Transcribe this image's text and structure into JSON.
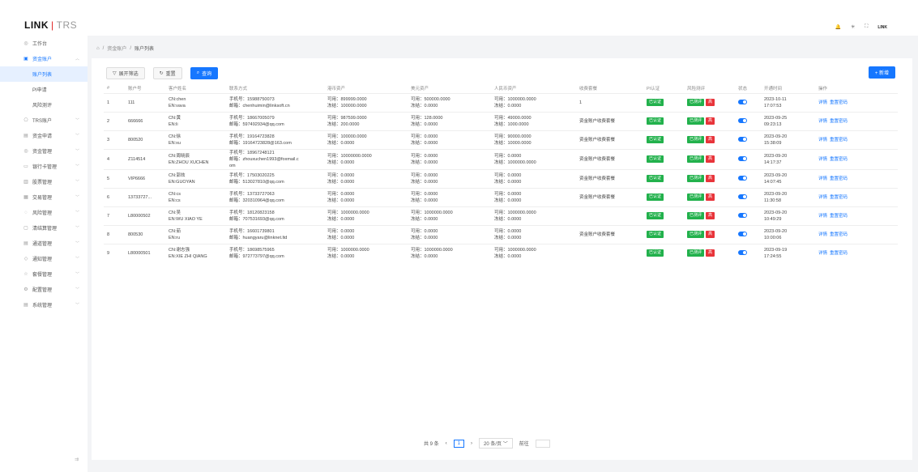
{
  "app": {
    "logo_bold": "LINK",
    "logo_sep": "|",
    "logo_rest": "TRS"
  },
  "topbar": {
    "bell": "🔔",
    "star": "✳",
    "expand": "⛶",
    "user": "LINK"
  },
  "sidebar": {
    "items": [
      {
        "label": "工作台",
        "icon": "◎",
        "chev": ""
      },
      {
        "label": "资金账户",
        "icon": "▣",
        "chev": "︿",
        "open": true
      },
      {
        "label": "TRS账户",
        "icon": "⎔",
        "chev": "﹀"
      },
      {
        "label": "资金申请",
        "icon": "▤",
        "chev": "﹀"
      },
      {
        "label": "资金管理",
        "icon": "◎",
        "chev": "﹀"
      },
      {
        "label": "银行卡管理",
        "icon": "▭",
        "chev": "﹀"
      },
      {
        "label": "股票管理",
        "icon": "▥",
        "chev": "﹀"
      },
      {
        "label": "交易管理",
        "icon": "▦",
        "chev": "﹀"
      },
      {
        "label": "风险管理",
        "icon": "◌",
        "chev": "﹀"
      },
      {
        "label": "清结算管理",
        "icon": "▢",
        "chev": "﹀"
      },
      {
        "label": "通道管理",
        "icon": "▤",
        "chev": "﹀"
      },
      {
        "label": "通知管理",
        "icon": "◇",
        "chev": "﹀"
      },
      {
        "label": "套餐管理",
        "icon": "☆",
        "chev": "﹀"
      },
      {
        "label": "配置管理",
        "icon": "⚙",
        "chev": "﹀"
      },
      {
        "label": "系统管理",
        "icon": "▤",
        "chev": "﹀"
      }
    ],
    "sub_items": [
      "账户列表",
      "PI申请",
      "风险测评"
    ],
    "collapse": "⇉"
  },
  "breadcrumb": {
    "home": "⌂",
    "sep": "/",
    "level1": "资金账户",
    "level2": "账户列表"
  },
  "toolbar": {
    "expand_filter": "展开筛选",
    "reset": "重置",
    "query": "查询",
    "add": "+ 新增"
  },
  "table": {
    "headers": [
      "#",
      "账户号",
      "客户姓名",
      "联系方式",
      "港币资产",
      "美元资产",
      "人民币资产",
      "收费套餐",
      "PI认证",
      "风险测评",
      "状态",
      "开通时间",
      "操作"
    ],
    "rows": [
      {
        "idx": "1",
        "acct": "111",
        "name1": "CN:chen",
        "name2": "EN:vava",
        "c1": "手机号：15988750073",
        "c2": "邮箱：chenhuimin@linksoft.cn",
        "hk1": "可用：899999.0000",
        "hk2": "冻结：100000.0000",
        "us1": "可用：500000.0000",
        "us2": "冻结：0.0000",
        "cn1": "可用：1000000.0000",
        "cn2": "冻结：0.0000",
        "fee": "1",
        "date": "2023-10-11",
        "time": "17:07:53"
      },
      {
        "idx": "2",
        "acct": "666666",
        "name1": "CN:黄",
        "name2": "EN:li",
        "c1": "手机号：18667005079",
        "c2": "邮箱：597492934@qq.com",
        "hk1": "可用：987599.0000",
        "hk2": "冻结：200.0000",
        "us1": "可用：128.0000",
        "us2": "冻结：0.0000",
        "cn1": "可用：49000.0000",
        "cn2": "冻结：1000.0000",
        "fee": "资金账户收费套餐",
        "date": "2023-09-25",
        "time": "09:23:13"
      },
      {
        "idx": "3",
        "acct": "800520",
        "name1": "CN:徐",
        "name2": "EN:xu",
        "c1": "手机号：19164723828",
        "c2": "邮箱：19164723828@163.com",
        "hk1": "可用：100000.0000",
        "hk2": "冻结：0.0000",
        "us1": "可用：0.0000",
        "us2": "冻结：0.0000",
        "cn1": "可用：90000.0000",
        "cn2": "冻结：10000.0000",
        "fee": "资金账户收费套餐",
        "date": "2023-09-20",
        "time": "15:38:09"
      },
      {
        "idx": "4",
        "acct": "Z114514",
        "name1": "CN:周晓辰",
        "name2": "EN:ZHOU XUCHEN",
        "c1": "手机号：18967248121",
        "c2": "邮箱：zhouxuchen1993@foxmail.c",
        "c3": "om",
        "hk1": "可用：10000000.0000",
        "hk2": "冻结：0.0000",
        "us1": "可用：0.0000",
        "us2": "冻结：0.0000",
        "cn1": "可用：0.0000",
        "cn2": "冻结：1000000.0000",
        "fee": "资金账户收费套餐",
        "date": "2023-09-20",
        "time": "14:17:37"
      },
      {
        "idx": "5",
        "acct": "VIP6666",
        "name1": "CN:郭炫",
        "name2": "EN:GUOYAN",
        "c1": "手机号：17503020225",
        "c2": "邮箱：513027810@qq.com",
        "hk1": "可用：0.0000",
        "hk2": "冻结：0.0000",
        "us1": "可用：0.0000",
        "us2": "冻结：0.0000",
        "cn1": "可用：0.0000",
        "cn2": "冻结：0.0000",
        "fee": "资金账户收费套餐",
        "date": "2023-09-20",
        "time": "14:07:45"
      },
      {
        "idx": "6",
        "acct": "13733727...",
        "name1": "CN:cs",
        "name2": "EN:cs",
        "c1": "手机号：13733727063",
        "c2": "邮箱：320310964@qq.com",
        "hk1": "可用：0.0000",
        "hk2": "冻结：0.0000",
        "us1": "可用：0.0000",
        "us2": "冻结：0.0000",
        "cn1": "可用：0.0000",
        "cn2": "冻结：0.0000",
        "fee": "资金账户收费套餐",
        "date": "2023-09-20",
        "time": "11:30:58"
      },
      {
        "idx": "7",
        "acct": "L80000502",
        "name1": "CN:吴",
        "name2": "EN:WU XIAO YE",
        "c1": "手机号：18120823158",
        "c2": "邮箱：707531693@qq.com",
        "hk1": "可用：1000000.0000",
        "hk2": "冻结：0.0000",
        "us1": "可用：1000000.0000",
        "us2": "冻结：0.0000",
        "cn1": "可用：1000000.0000",
        "cn2": "冻结：0.0000",
        "fee": "",
        "date": "2023-09-20",
        "time": "10:49:29"
      },
      {
        "idx": "8",
        "acct": "800530",
        "name1": "CN:茹",
        "name2": "EN:ru",
        "c1": "手机号：16601739801",
        "c2": "邮箱：huangyaru@linknet.ltd",
        "hk1": "可用：0.0000",
        "hk2": "冻结：0.0000",
        "us1": "可用：0.0000",
        "us2": "冻结：0.0000",
        "cn1": "可用：0.0000",
        "cn2": "冻结：0.0000",
        "fee": "资金账户收费套餐",
        "date": "2023-09-20",
        "time": "10:00:06"
      },
      {
        "idx": "9",
        "acct": "L80000501",
        "name1": "CN:谢志强",
        "name2": "EN:XIE ZHI QIANG",
        "c1": "手机号：18698575965",
        "c2": "邮箱：972773797@qq.com",
        "hk1": "可用：1000000.0000",
        "hk2": "冻结：0.0000",
        "us1": "可用：1000000.0000",
        "us2": "冻结：0.0000",
        "cn1": "可用：1000000.0000",
        "cn2": "冻结：0.0000",
        "fee": "",
        "date": "2023-09-19",
        "time": "17:24:55"
      }
    ],
    "pi_tag": "已认证",
    "risk_tag": "已测评",
    "risk_level": "高",
    "op_detail": "详情",
    "op_reset": "重置密码"
  },
  "pager": {
    "total": "共 9 条",
    "prev": "‹",
    "page": "1",
    "next": "›",
    "size": "20 条/页",
    "size_caret": "﹀",
    "goto": "前往"
  },
  "colors": {
    "primary": "#1677ff",
    "success": "#22b14c",
    "danger": "#e8343a"
  }
}
